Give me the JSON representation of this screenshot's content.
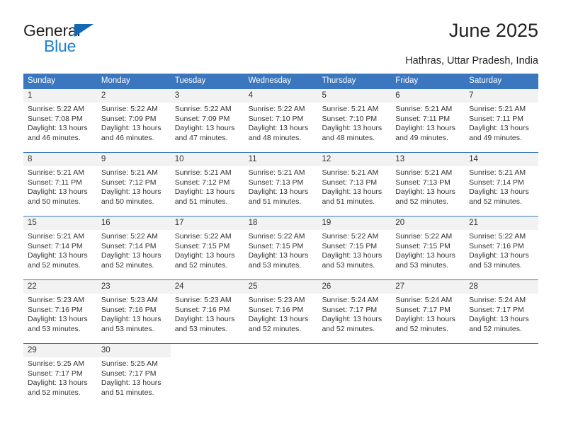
{
  "brand": {
    "name_part1": "General",
    "name_part2": "Blue",
    "triangle_color": "#1268b3",
    "blue_color": "#1b7fd4"
  },
  "header": {
    "title": "June 2025",
    "subtitle": "Hathras, Uttar Pradesh, India",
    "header_bg_color": "#3a77bf",
    "daynum_band_color": "#f2f2f2"
  },
  "weekdays": [
    "Sunday",
    "Monday",
    "Tuesday",
    "Wednesday",
    "Thursday",
    "Friday",
    "Saturday"
  ],
  "weeks": [
    [
      {
        "day": "1",
        "sunrise": "Sunrise: 5:22 AM",
        "sunset": "Sunset: 7:08 PM",
        "daylight_line1": "Daylight: 13 hours",
        "daylight_line2": "and 46 minutes."
      },
      {
        "day": "2",
        "sunrise": "Sunrise: 5:22 AM",
        "sunset": "Sunset: 7:09 PM",
        "daylight_line1": "Daylight: 13 hours",
        "daylight_line2": "and 46 minutes."
      },
      {
        "day": "3",
        "sunrise": "Sunrise: 5:22 AM",
        "sunset": "Sunset: 7:09 PM",
        "daylight_line1": "Daylight: 13 hours",
        "daylight_line2": "and 47 minutes."
      },
      {
        "day": "4",
        "sunrise": "Sunrise: 5:22 AM",
        "sunset": "Sunset: 7:10 PM",
        "daylight_line1": "Daylight: 13 hours",
        "daylight_line2": "and 48 minutes."
      },
      {
        "day": "5",
        "sunrise": "Sunrise: 5:21 AM",
        "sunset": "Sunset: 7:10 PM",
        "daylight_line1": "Daylight: 13 hours",
        "daylight_line2": "and 48 minutes."
      },
      {
        "day": "6",
        "sunrise": "Sunrise: 5:21 AM",
        "sunset": "Sunset: 7:11 PM",
        "daylight_line1": "Daylight: 13 hours",
        "daylight_line2": "and 49 minutes."
      },
      {
        "day": "7",
        "sunrise": "Sunrise: 5:21 AM",
        "sunset": "Sunset: 7:11 PM",
        "daylight_line1": "Daylight: 13 hours",
        "daylight_line2": "and 49 minutes."
      }
    ],
    [
      {
        "day": "8",
        "sunrise": "Sunrise: 5:21 AM",
        "sunset": "Sunset: 7:11 PM",
        "daylight_line1": "Daylight: 13 hours",
        "daylight_line2": "and 50 minutes."
      },
      {
        "day": "9",
        "sunrise": "Sunrise: 5:21 AM",
        "sunset": "Sunset: 7:12 PM",
        "daylight_line1": "Daylight: 13 hours",
        "daylight_line2": "and 50 minutes."
      },
      {
        "day": "10",
        "sunrise": "Sunrise: 5:21 AM",
        "sunset": "Sunset: 7:12 PM",
        "daylight_line1": "Daylight: 13 hours",
        "daylight_line2": "and 51 minutes."
      },
      {
        "day": "11",
        "sunrise": "Sunrise: 5:21 AM",
        "sunset": "Sunset: 7:13 PM",
        "daylight_line1": "Daylight: 13 hours",
        "daylight_line2": "and 51 minutes."
      },
      {
        "day": "12",
        "sunrise": "Sunrise: 5:21 AM",
        "sunset": "Sunset: 7:13 PM",
        "daylight_line1": "Daylight: 13 hours",
        "daylight_line2": "and 51 minutes."
      },
      {
        "day": "13",
        "sunrise": "Sunrise: 5:21 AM",
        "sunset": "Sunset: 7:13 PM",
        "daylight_line1": "Daylight: 13 hours",
        "daylight_line2": "and 52 minutes."
      },
      {
        "day": "14",
        "sunrise": "Sunrise: 5:21 AM",
        "sunset": "Sunset: 7:14 PM",
        "daylight_line1": "Daylight: 13 hours",
        "daylight_line2": "and 52 minutes."
      }
    ],
    [
      {
        "day": "15",
        "sunrise": "Sunrise: 5:21 AM",
        "sunset": "Sunset: 7:14 PM",
        "daylight_line1": "Daylight: 13 hours",
        "daylight_line2": "and 52 minutes."
      },
      {
        "day": "16",
        "sunrise": "Sunrise: 5:22 AM",
        "sunset": "Sunset: 7:14 PM",
        "daylight_line1": "Daylight: 13 hours",
        "daylight_line2": "and 52 minutes."
      },
      {
        "day": "17",
        "sunrise": "Sunrise: 5:22 AM",
        "sunset": "Sunset: 7:15 PM",
        "daylight_line1": "Daylight: 13 hours",
        "daylight_line2": "and 52 minutes."
      },
      {
        "day": "18",
        "sunrise": "Sunrise: 5:22 AM",
        "sunset": "Sunset: 7:15 PM",
        "daylight_line1": "Daylight: 13 hours",
        "daylight_line2": "and 53 minutes."
      },
      {
        "day": "19",
        "sunrise": "Sunrise: 5:22 AM",
        "sunset": "Sunset: 7:15 PM",
        "daylight_line1": "Daylight: 13 hours",
        "daylight_line2": "and 53 minutes."
      },
      {
        "day": "20",
        "sunrise": "Sunrise: 5:22 AM",
        "sunset": "Sunset: 7:15 PM",
        "daylight_line1": "Daylight: 13 hours",
        "daylight_line2": "and 53 minutes."
      },
      {
        "day": "21",
        "sunrise": "Sunrise: 5:22 AM",
        "sunset": "Sunset: 7:16 PM",
        "daylight_line1": "Daylight: 13 hours",
        "daylight_line2": "and 53 minutes."
      }
    ],
    [
      {
        "day": "22",
        "sunrise": "Sunrise: 5:23 AM",
        "sunset": "Sunset: 7:16 PM",
        "daylight_line1": "Daylight: 13 hours",
        "daylight_line2": "and 53 minutes."
      },
      {
        "day": "23",
        "sunrise": "Sunrise: 5:23 AM",
        "sunset": "Sunset: 7:16 PM",
        "daylight_line1": "Daylight: 13 hours",
        "daylight_line2": "and 53 minutes."
      },
      {
        "day": "24",
        "sunrise": "Sunrise: 5:23 AM",
        "sunset": "Sunset: 7:16 PM",
        "daylight_line1": "Daylight: 13 hours",
        "daylight_line2": "and 53 minutes."
      },
      {
        "day": "25",
        "sunrise": "Sunrise: 5:23 AM",
        "sunset": "Sunset: 7:16 PM",
        "daylight_line1": "Daylight: 13 hours",
        "daylight_line2": "and 52 minutes."
      },
      {
        "day": "26",
        "sunrise": "Sunrise: 5:24 AM",
        "sunset": "Sunset: 7:17 PM",
        "daylight_line1": "Daylight: 13 hours",
        "daylight_line2": "and 52 minutes."
      },
      {
        "day": "27",
        "sunrise": "Sunrise: 5:24 AM",
        "sunset": "Sunset: 7:17 PM",
        "daylight_line1": "Daylight: 13 hours",
        "daylight_line2": "and 52 minutes."
      },
      {
        "day": "28",
        "sunrise": "Sunrise: 5:24 AM",
        "sunset": "Sunset: 7:17 PM",
        "daylight_line1": "Daylight: 13 hours",
        "daylight_line2": "and 52 minutes."
      }
    ],
    [
      {
        "day": "29",
        "sunrise": "Sunrise: 5:25 AM",
        "sunset": "Sunset: 7:17 PM",
        "daylight_line1": "Daylight: 13 hours",
        "daylight_line2": "and 52 minutes."
      },
      {
        "day": "30",
        "sunrise": "Sunrise: 5:25 AM",
        "sunset": "Sunset: 7:17 PM",
        "daylight_line1": "Daylight: 13 hours",
        "daylight_line2": "and 51 minutes."
      },
      {
        "day": "",
        "sunrise": "",
        "sunset": "",
        "daylight_line1": "",
        "daylight_line2": ""
      },
      {
        "day": "",
        "sunrise": "",
        "sunset": "",
        "daylight_line1": "",
        "daylight_line2": ""
      },
      {
        "day": "",
        "sunrise": "",
        "sunset": "",
        "daylight_line1": "",
        "daylight_line2": ""
      },
      {
        "day": "",
        "sunrise": "",
        "sunset": "",
        "daylight_line1": "",
        "daylight_line2": ""
      },
      {
        "day": "",
        "sunrise": "",
        "sunset": "",
        "daylight_line1": "",
        "daylight_line2": ""
      }
    ]
  ]
}
